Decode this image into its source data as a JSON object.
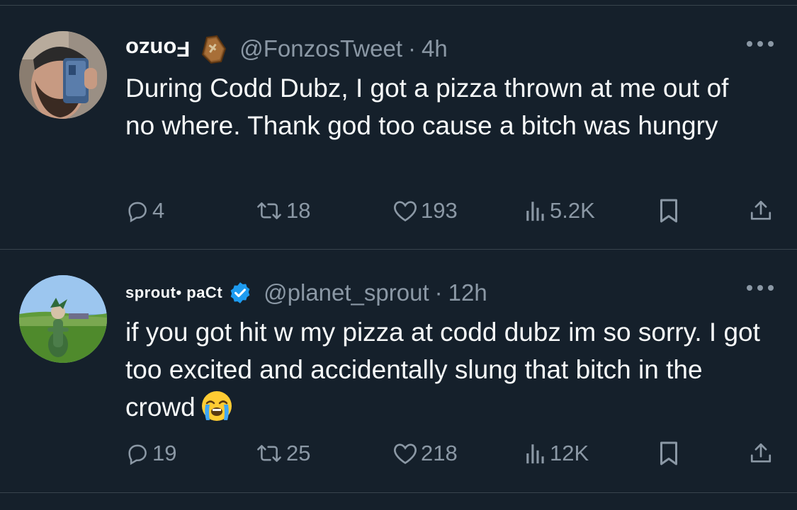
{
  "tweets": [
    {
      "display_name": "Fonzo",
      "name_emoji": "coffin-icon",
      "handle": "@FonzosTweet",
      "separator": "·",
      "time": "4h",
      "text": "During Codd Dubz, I got a pizza thrown at me out of no where. Thank god too cause a bitch was hungry",
      "replies": "4",
      "retweets": "18",
      "likes": "193",
      "views": "5.2K"
    },
    {
      "display_name": "sprout• paCt",
      "verified": true,
      "handle": "@planet_sprout",
      "separator": "·",
      "time": "12h",
      "text": "if you got hit w my pizza at codd dubz im so sorry. I got too excited and accidentally slung that bitch in the crowd",
      "text_emoji": "loudly-crying-face-emoji",
      "replies": "19",
      "retweets": "25",
      "likes": "218",
      "views": "12K"
    }
  ],
  "colors": {
    "background": "#15202b",
    "text": "#f7f9f9",
    "secondary": "#8b98a5",
    "divider": "#38444d",
    "verified": "#1d9bf0"
  }
}
